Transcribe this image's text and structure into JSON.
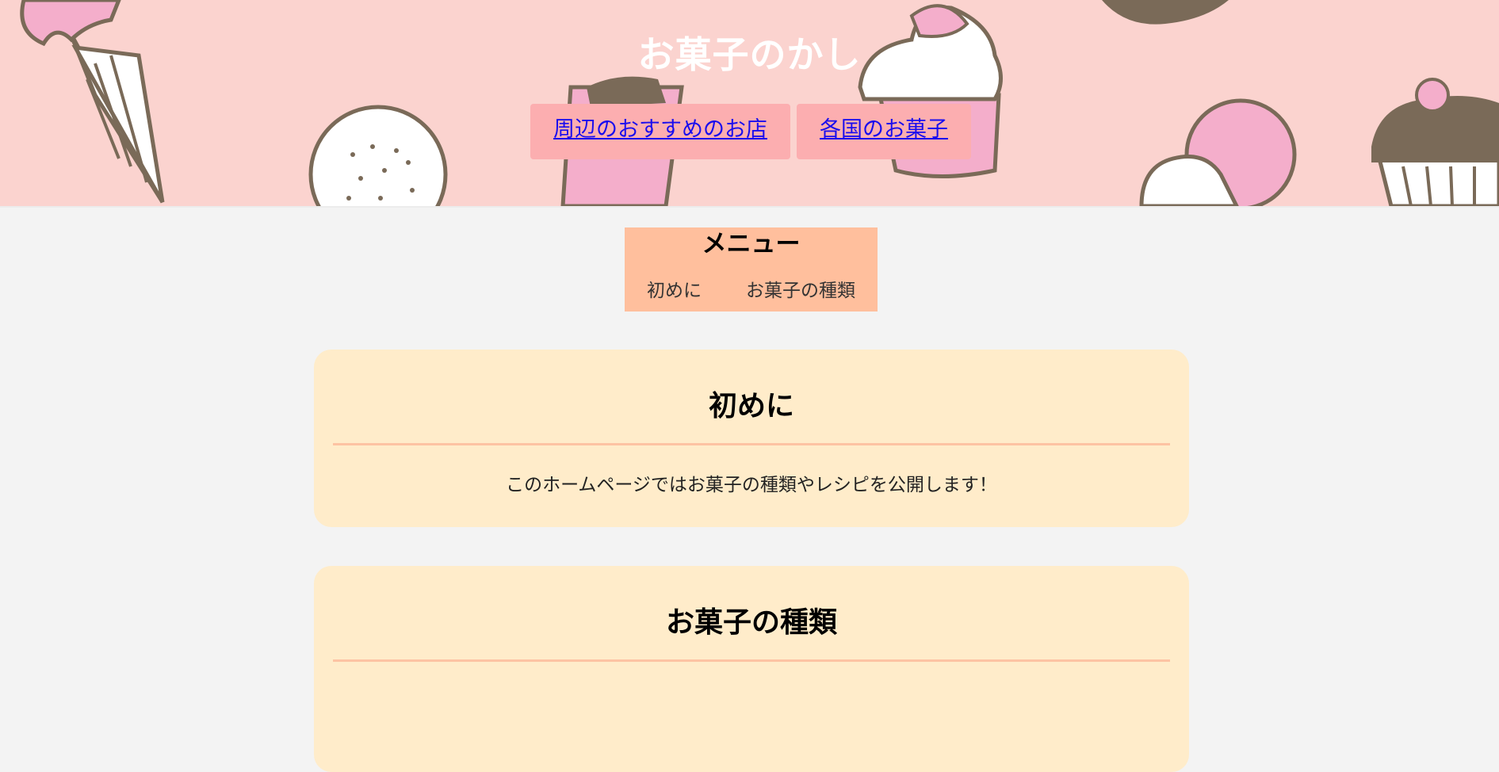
{
  "header": {
    "title": "お菓子のかし",
    "nav": [
      {
        "label": "周辺のおすすめのお店"
      },
      {
        "label": "各国のお菓子"
      }
    ]
  },
  "menu": {
    "title": "メニュー",
    "items": [
      {
        "label": "初めに"
      },
      {
        "label": "お菓子の種類"
      }
    ]
  },
  "sections": [
    {
      "title": "初めに",
      "body": "このホームページではお菓子の種類やレシピを公開します！"
    },
    {
      "title": "お菓子の種類",
      "body": ""
    }
  ],
  "colors": {
    "header_bg": "#fbd3cf",
    "nav_button": "#fcaeb0",
    "link": "#1a0dee",
    "menu_bg": "#ffbf9d",
    "card_bg": "#ffecca",
    "card_rule": "#fdc3a3",
    "page_bg": "#f3f3f3"
  }
}
